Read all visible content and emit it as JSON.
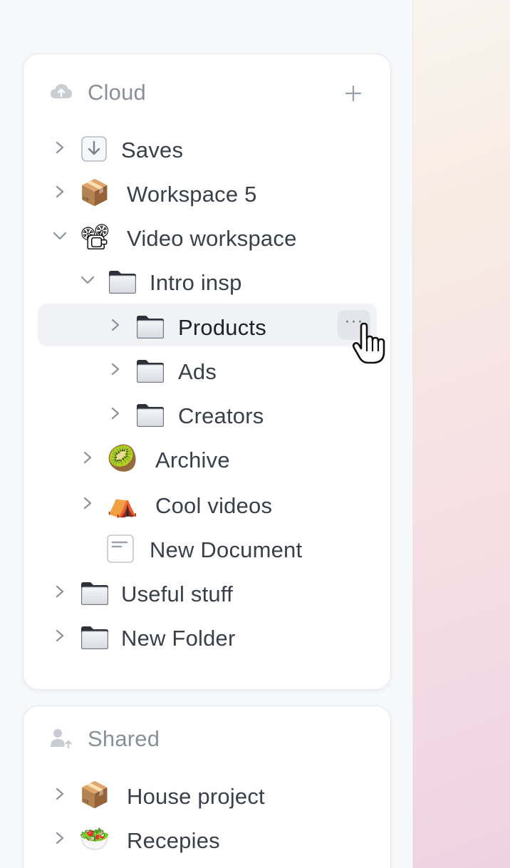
{
  "cloud": {
    "title": "Cloud",
    "add_label": "+",
    "items": [
      {
        "label": "Saves",
        "icon": "download-box-icon"
      },
      {
        "label": "Workspace 5",
        "icon": "package-emoji",
        "emoji": "📦"
      },
      {
        "label": "Video workspace",
        "icon": "film-projector-emoji",
        "emoji": "📽"
      },
      {
        "label": "Intro insp",
        "icon": "folder-icon"
      },
      {
        "label": "Products",
        "icon": "folder-icon"
      },
      {
        "label": "Ads",
        "icon": "folder-icon"
      },
      {
        "label": "Creators",
        "icon": "folder-icon"
      },
      {
        "label": "Archive",
        "icon": "kiwi-emoji",
        "emoji": "🥝"
      },
      {
        "label": "Cool videos",
        "icon": "tent-emoji",
        "emoji": "⛺"
      },
      {
        "label": "New Document",
        "icon": "document-icon"
      },
      {
        "label": "Useful stuff",
        "icon": "folder-icon"
      },
      {
        "label": "New Folder",
        "icon": "folder-icon"
      }
    ],
    "more_label": "···"
  },
  "shared": {
    "title": "Shared",
    "items": [
      {
        "label": "House project",
        "icon": "package-emoji",
        "emoji": "📦"
      },
      {
        "label": "Recepies",
        "icon": "salad-emoji",
        "emoji": "🥗"
      }
    ]
  }
}
